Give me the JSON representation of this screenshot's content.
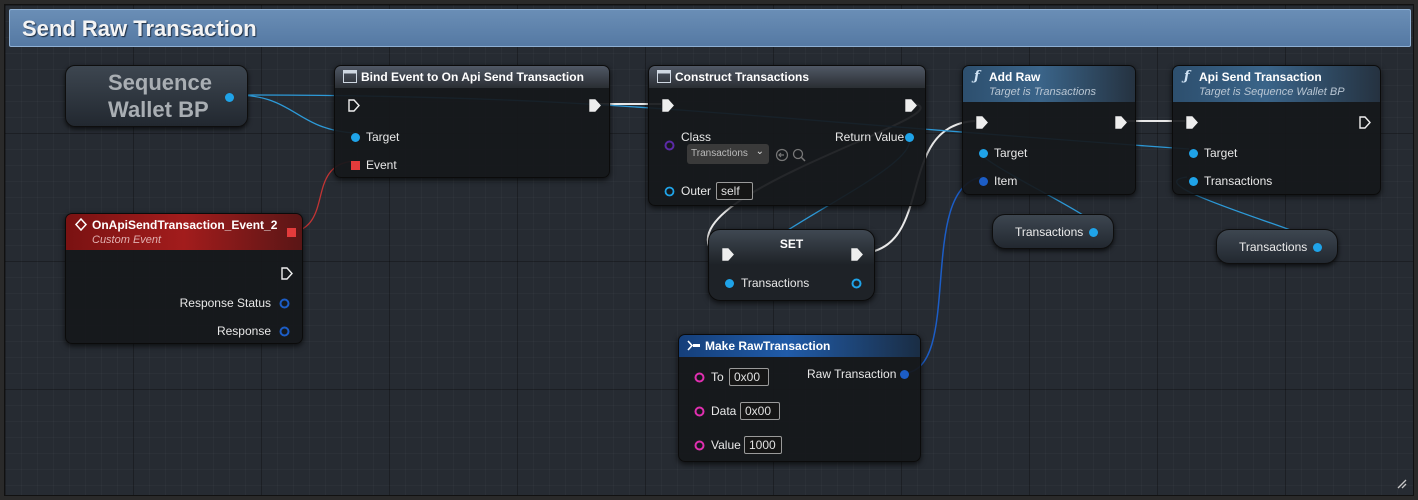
{
  "comment": {
    "title": "Send Raw Transaction"
  },
  "colors": {
    "header": "#5f84ad",
    "object_pin": "#1fa3e8",
    "struct_pin": "#1c5dc6",
    "string_pin": "#e02fb0",
    "delegate_pin": "#e33b3b",
    "class_pin": "#5b2aa6"
  },
  "nodes": {
    "sequence_var": {
      "label_line1": "Sequence",
      "label_line2": "Wallet BP"
    },
    "bind_event": {
      "title": "Bind Event to On Api Send Transaction",
      "pins": {
        "target": "Target",
        "event": "Event"
      },
      "icon": "function-node-icon"
    },
    "construct": {
      "title": "Construct Transactions",
      "pins": {
        "class": "Class",
        "class_value": "Transactions",
        "outer": "Outer",
        "outer_value": "self",
        "return_value": "Return Value"
      },
      "icon": "construct-node-icon"
    },
    "add_raw": {
      "title": "Add Raw",
      "subtitle": "Target is Transactions",
      "pins": {
        "target": "Target",
        "item": "Item"
      }
    },
    "api_send": {
      "title": "Api Send Transaction",
      "subtitle": "Target is Sequence Wallet BP",
      "pins": {
        "target": "Target",
        "transactions": "Transactions"
      }
    },
    "custom_event": {
      "title": "OnApiSendTransaction_Event_2",
      "subtitle": "Custom Event",
      "pins": {
        "response_status": "Response Status",
        "response": "Response"
      }
    },
    "set_node": {
      "title": "SET",
      "pins": {
        "transactions": "Transactions"
      }
    },
    "transactions_var_1": {
      "label": "Transactions"
    },
    "transactions_var_2": {
      "label": "Transactions"
    },
    "make_raw": {
      "title": "Make RawTransaction",
      "pins": {
        "to": "To",
        "to_value": "0x00",
        "data": "Data",
        "data_value": "0x00",
        "value": "Value",
        "value_value": "1000",
        "raw_transaction": "Raw Transaction"
      }
    }
  }
}
